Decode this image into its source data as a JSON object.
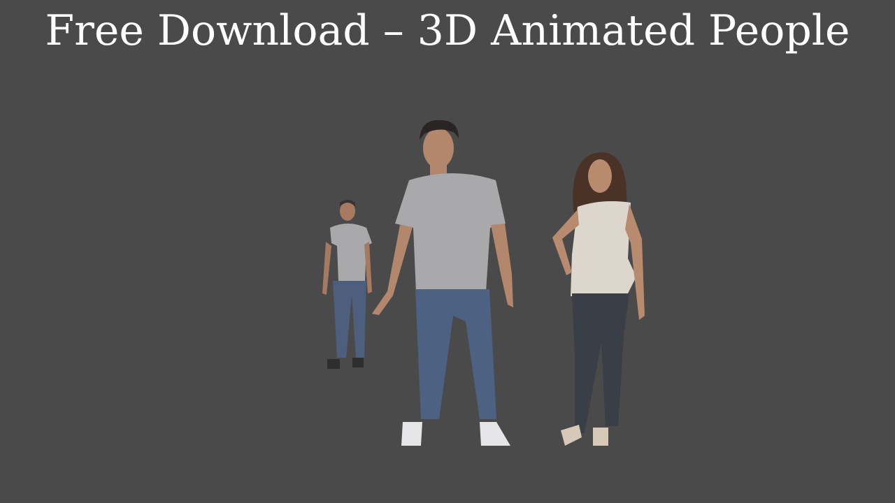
{
  "title": "Free Download – 3D Animated People",
  "colors": {
    "background": "#4a4a4a",
    "title": "#ffffff",
    "shirt": "#a9a9ab",
    "jeans": "#4d6282",
    "skin": "#b88a6e",
    "hair": "#2a2524",
    "top_white": "#dcd6cc",
    "dark_jeans": "#3a3e46"
  }
}
